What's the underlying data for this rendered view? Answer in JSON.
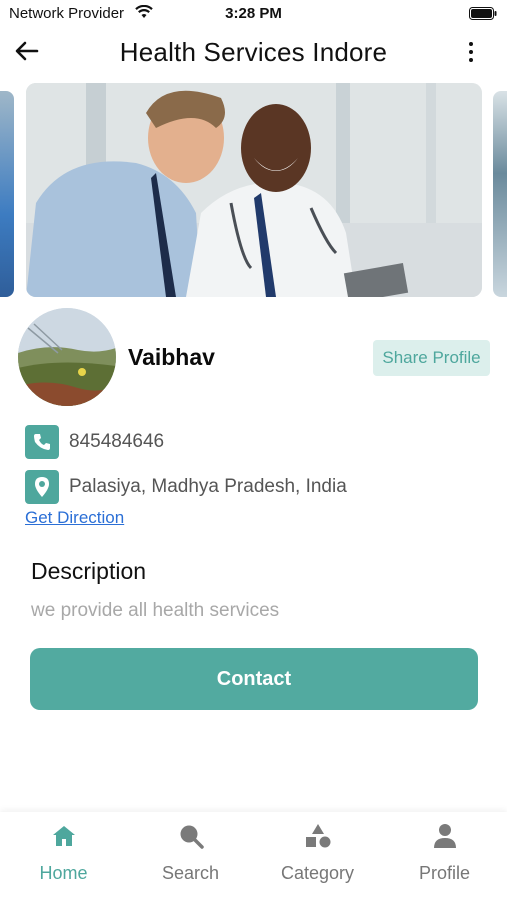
{
  "status": {
    "provider": "Network Provider",
    "time": "3:28 PM"
  },
  "header": {
    "title": "Health Services Indore"
  },
  "profile": {
    "name": "Vaibhav",
    "share_label": "Share Profile"
  },
  "contact": {
    "phone": "845484646",
    "location": "Palasiya, Madhya Pradesh, India",
    "direction_label": "Get Direction"
  },
  "description": {
    "title": "Description",
    "text": "we provide all health services"
  },
  "actions": {
    "contact_label": "Contact"
  },
  "nav": [
    {
      "label": "Home",
      "icon": "home-icon",
      "active": true
    },
    {
      "label": "Search",
      "icon": "search-icon",
      "active": false
    },
    {
      "label": "Category",
      "icon": "category-icon",
      "active": false
    },
    {
      "label": "Profile",
      "icon": "profile-icon",
      "active": false
    }
  ],
  "colors": {
    "accent": "#52aaa0",
    "accent_light": "#dcefec",
    "link": "#2b6fd6"
  }
}
